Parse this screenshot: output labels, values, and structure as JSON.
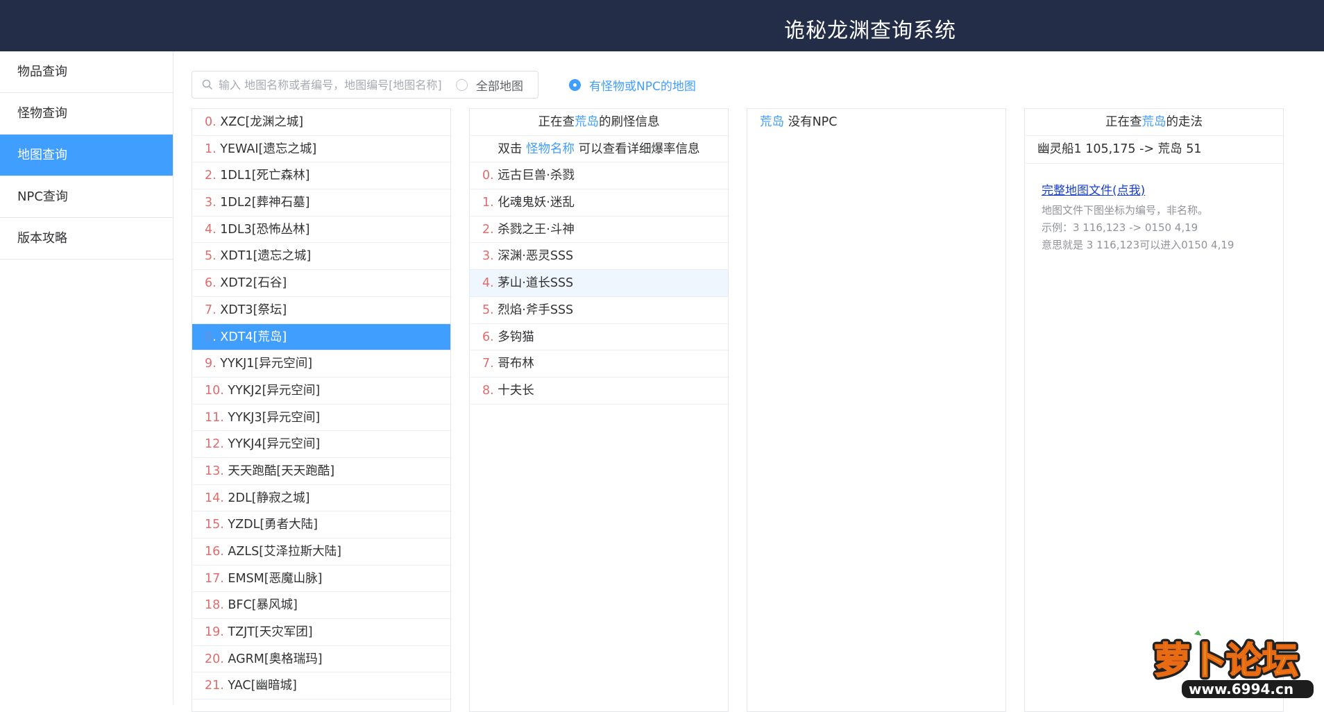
{
  "header": {
    "title": "诡秘龙渊查询系统"
  },
  "sidebar": {
    "items": [
      {
        "label": "物品查询",
        "active": false
      },
      {
        "label": "怪物查询",
        "active": false
      },
      {
        "label": "地图查询",
        "active": true
      },
      {
        "label": "NPC查询",
        "active": false
      },
      {
        "label": "版本攻略",
        "active": false
      }
    ]
  },
  "search": {
    "placeholder": "输入 地图名称或者编号，地图编号[地图名称]",
    "value": ""
  },
  "filters": {
    "all_maps": {
      "label": "全部地图",
      "checked": false
    },
    "with_npc": {
      "label": "有怪物或NPC的地图",
      "checked": true
    }
  },
  "maps": [
    {
      "idx": "0",
      "name": "XZC[龙渊之城]"
    },
    {
      "idx": "1",
      "name": "YEWAI[遗忘之城]"
    },
    {
      "idx": "2",
      "name": "1DL1[死亡森林]"
    },
    {
      "idx": "3",
      "name": "1DL2[葬神石墓]"
    },
    {
      "idx": "4",
      "name": "1DL3[恐怖丛林]"
    },
    {
      "idx": "5",
      "name": "XDT1[遗忘之城]"
    },
    {
      "idx": "6",
      "name": "XDT2[石谷]"
    },
    {
      "idx": "7",
      "name": "XDT3[祭坛]"
    },
    {
      "idx": "8",
      "name": "XDT4[荒岛]"
    },
    {
      "idx": "9",
      "name": "YYKJ1[异元空间]"
    },
    {
      "idx": "10",
      "name": "YYKJ2[异元空间]"
    },
    {
      "idx": "11",
      "name": "YYKJ3[异元空间]"
    },
    {
      "idx": "12",
      "name": "YYKJ4[异元空间]"
    },
    {
      "idx": "13",
      "name": "天天跑酷[天天跑酷]"
    },
    {
      "idx": "14",
      "name": "2DL[静寂之城]"
    },
    {
      "idx": "15",
      "name": "YZDL[勇者大陆]"
    },
    {
      "idx": "16",
      "name": "AZLS[艾泽拉斯大陆]"
    },
    {
      "idx": "17",
      "name": "EMSM[恶魔山脉]"
    },
    {
      "idx": "18",
      "name": "BFC[暴风城]"
    },
    {
      "idx": "19",
      "name": "TZJT[天灾军团]"
    },
    {
      "idx": "20",
      "name": "AGRM[奥格瑞玛]"
    },
    {
      "idx": "21",
      "name": "YAC[幽暗城]"
    }
  ],
  "selected_map_index": 8,
  "monsters_panel": {
    "header_prefix": "正在查",
    "map_name": "荒岛",
    "header_suffix": "的刷怪信息",
    "tip_prefix": "双击 ",
    "tip_link": "怪物名称",
    "tip_suffix": " 可以查看详细爆率信息",
    "hover_index": 4,
    "items": [
      {
        "idx": "0",
        "name": "远古巨兽·杀戮"
      },
      {
        "idx": "1",
        "name": "化魂鬼妖·迷乱"
      },
      {
        "idx": "2",
        "name": "杀戮之王·斗神"
      },
      {
        "idx": "3",
        "name": "深渊·恶灵SSS"
      },
      {
        "idx": "4",
        "name": "茅山·道长SSS"
      },
      {
        "idx": "5",
        "name": "烈焰·斧手SSS"
      },
      {
        "idx": "6",
        "name": "多钩猫"
      },
      {
        "idx": "7",
        "name": "哥布林"
      },
      {
        "idx": "8",
        "name": "十夫长"
      }
    ]
  },
  "npc_panel": {
    "map_name": "荒岛",
    "text": " 没有NPC"
  },
  "route_panel": {
    "header_prefix": "正在查",
    "map_name": "荒岛",
    "header_suffix": "的走法",
    "route": "幽灵船1 105,175 -> 荒岛 51",
    "link": "完整地图文件(点我)",
    "note1": "地图文件下图坐标为编号，非名称。",
    "note2": "示例：3 116,123 -> 0150 4,19",
    "note3": "意思就是 3 116,123可以进入0150 4,19"
  },
  "watermark": {
    "text": "萝卜论坛",
    "url": "www.6994.cn"
  },
  "colors": {
    "accent": "#409eff",
    "header_bg": "#242d47",
    "index_red": "#e06c6c"
  }
}
